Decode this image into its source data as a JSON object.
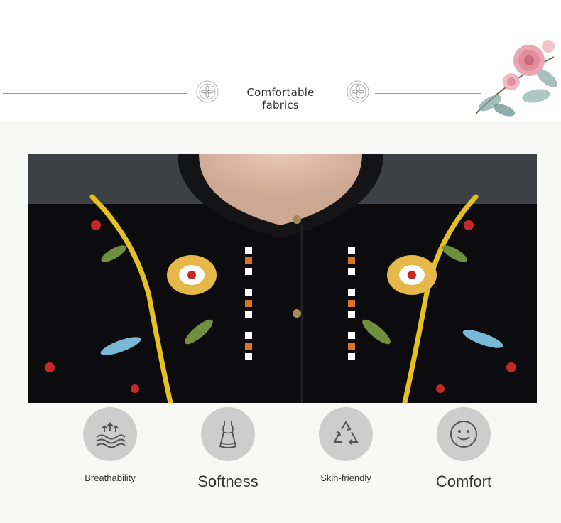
{
  "section": {
    "title": "Comfortable fabrics"
  },
  "features": [
    {
      "label": "Breathability",
      "icon": "breathability-icon"
    },
    {
      "label": "Softness",
      "icon": "dress-icon"
    },
    {
      "label": "Skin-friendly",
      "icon": "recycle-icon"
    },
    {
      "label": "Comfort",
      "icon": "smiley-icon"
    }
  ],
  "colors": {
    "icon_circle": "#cdcdcd",
    "icon_stroke": "#555555",
    "fabric": "#0c0c0e",
    "embroidery_gold": "#e4c020",
    "embroidery_red": "#c62828"
  }
}
